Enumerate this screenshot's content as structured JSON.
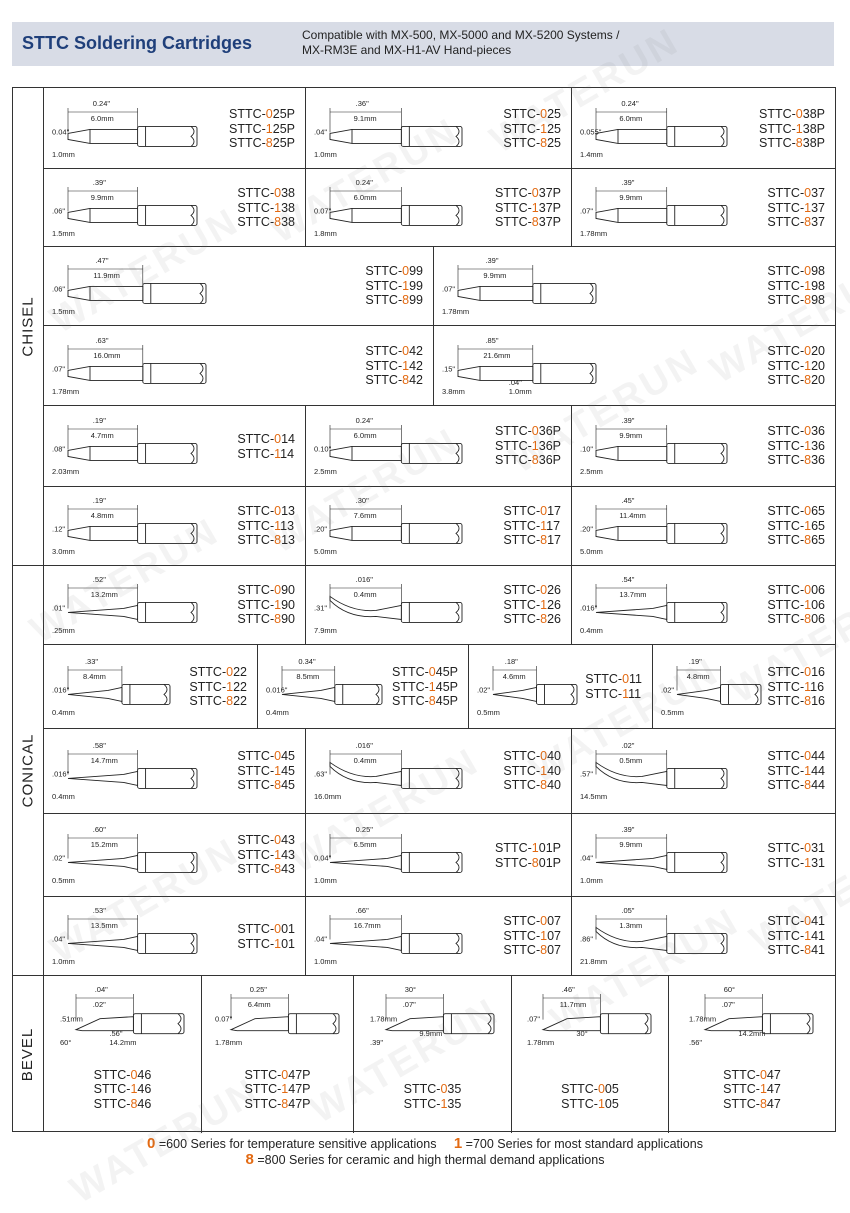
{
  "header": {
    "title": "STTC Soldering Cartridges",
    "compat_line1": "Compatible with MX-500, MX-5000 and MX-5200 Systems /",
    "compat_line2": "MX-RM3E and MX-H1-AV Hand-pieces"
  },
  "sections": [
    {
      "label": "CHISEL"
    },
    {
      "label": "CONICAL"
    },
    {
      "label": "BEVEL"
    }
  ],
  "watermark": "WATERUN",
  "rows": [
    {
      "cells": [
        {
          "parts": [
            [
              "STTC-",
              "0",
              "25P"
            ],
            [
              "STTC-",
              "1",
              "25P"
            ],
            [
              "STTC-",
              "8",
              "25P"
            ]
          ],
          "dims": [
            "0.24\"",
            "6.0mm",
            "0.04\"",
            "1.0mm"
          ]
        },
        {
          "parts": [
            [
              "STTC-",
              "0",
              "25"
            ],
            [
              "STTC-",
              "1",
              "25"
            ],
            [
              "STTC-",
              "8",
              "25"
            ]
          ],
          "dims": [
            ".36\"",
            "9.1mm",
            ".04\"",
            "1.0mm"
          ]
        },
        {
          "parts": [
            [
              "STTC-",
              "0",
              "38P"
            ],
            [
              "STTC-",
              "1",
              "38P"
            ],
            [
              "STTC-",
              "8",
              "38P"
            ]
          ],
          "dims": [
            "0.24\"",
            "6.0mm",
            "0.055\"",
            "1.4mm"
          ]
        }
      ]
    },
    {
      "cells": [
        {
          "parts": [
            [
              "STTC-",
              "0",
              "38"
            ],
            [
              "STTC-",
              "1",
              "38"
            ],
            [
              "STTC-",
              "8",
              "38"
            ]
          ],
          "dims": [
            ".39\"",
            "9.9mm",
            ".06\"",
            "1.5mm"
          ]
        },
        {
          "parts": [
            [
              "STTC-",
              "0",
              "37P"
            ],
            [
              "STTC-",
              "1",
              "37P"
            ],
            [
              "STTC-",
              "8",
              "37P"
            ]
          ],
          "dims": [
            "0.24\"",
            "6.0mm",
            "0.07\"",
            "1.8mm"
          ]
        },
        {
          "parts": [
            [
              "STTC-",
              "0",
              "37"
            ],
            [
              "STTC-",
              "1",
              "37"
            ],
            [
              "STTC-",
              "8",
              "37"
            ]
          ],
          "dims": [
            ".39\"",
            "9.9mm",
            ".07\"",
            "1.78mm"
          ]
        }
      ]
    },
    {
      "cells": [
        {
          "parts": [
            [
              "STTC-",
              "0",
              "99"
            ],
            [
              "STTC-",
              "1",
              "99"
            ],
            [
              "STTC-",
              "8",
              "99"
            ]
          ],
          "dims": [
            ".47\"",
            "11.9mm",
            ".06\"",
            "1.5mm"
          ]
        },
        {
          "parts": [
            [
              "STTC-",
              "0",
              "98"
            ],
            [
              "STTC-",
              "1",
              "98"
            ],
            [
              "STTC-",
              "8",
              "98"
            ]
          ],
          "dims": [
            ".39\"",
            "9.9mm",
            ".07\"",
            "1.78mm"
          ]
        }
      ]
    },
    {
      "cells": [
        {
          "parts": [
            [
              "STTC-",
              "0",
              "42"
            ],
            [
              "STTC-",
              "1",
              "42"
            ],
            [
              "STTC-",
              "8",
              "42"
            ]
          ],
          "dims": [
            ".63\"",
            "16.0mm",
            ".07\"",
            "1.78mm"
          ]
        },
        {
          "parts": [
            [
              "STTC-",
              "0",
              "20"
            ],
            [
              "STTC-",
              "1",
              "20"
            ],
            [
              "STTC-",
              "8",
              "20"
            ]
          ],
          "dims": [
            ".85\"",
            "21.6mm",
            ".15\"",
            "3.8mm",
            ".04\"",
            "1.0mm"
          ]
        }
      ]
    },
    {
      "cells": [
        {
          "parts": [
            [
              "STTC-",
              "0",
              "14"
            ],
            [
              "STTC-",
              "1",
              "14"
            ]
          ],
          "dims": [
            ".19\"",
            "4.7mm",
            ".08\"",
            "2.03mm"
          ]
        },
        {
          "parts": [
            [
              "STTC-",
              "0",
              "36P"
            ],
            [
              "STTC-",
              "1",
              "36P"
            ],
            [
              "STTC-",
              "8",
              "36P"
            ]
          ],
          "dims": [
            "0.24\"",
            "6.0mm",
            "0.10\"",
            "2.5mm"
          ]
        },
        {
          "parts": [
            [
              "STTC-",
              "0",
              "36"
            ],
            [
              "STTC-",
              "1",
              "36"
            ],
            [
              "STTC-",
              "8",
              "36"
            ]
          ],
          "dims": [
            ".39\"",
            "9.9mm",
            ".10\"",
            "2.5mm"
          ]
        }
      ]
    },
    {
      "cells": [
        {
          "parts": [
            [
              "STTC-",
              "0",
              "13"
            ],
            [
              "STTC-",
              "1",
              "13"
            ],
            [
              "STTC-",
              "8",
              "13"
            ]
          ],
          "dims": [
            ".19\"",
            "4.8mm",
            ".12\"",
            "3.0mm"
          ]
        },
        {
          "parts": [
            [
              "STTC-",
              "0",
              "17"
            ],
            [
              "STTC-",
              "1",
              "17"
            ],
            [
              "STTC-",
              "8",
              "17"
            ]
          ],
          "dims": [
            ".30\"",
            "7.6mm",
            ".20\"",
            "5.0mm"
          ]
        },
        {
          "parts": [
            [
              "STTC-",
              "0",
              "65"
            ],
            [
              "STTC-",
              "1",
              "65"
            ],
            [
              "STTC-",
              "8",
              "65"
            ]
          ],
          "dims": [
            ".45\"",
            "11.4mm",
            ".20\"",
            "5.0mm"
          ]
        }
      ]
    },
    {
      "cells": [
        {
          "parts": [
            [
              "STTC-",
              "0",
              "90"
            ],
            [
              "STTC-",
              "1",
              "90"
            ],
            [
              "STTC-",
              "8",
              "90"
            ]
          ],
          "dims": [
            ".52\"",
            "13.2mm",
            ".01\"",
            ".25mm"
          ]
        },
        {
          "parts": [
            [
              "STTC-",
              "0",
              "26"
            ],
            [
              "STTC-",
              "1",
              "26"
            ],
            [
              "STTC-",
              "8",
              "26"
            ]
          ],
          "dims": [
            ".016\"",
            "0.4mm",
            ".31\"",
            "7.9mm"
          ]
        },
        {
          "parts": [
            [
              "STTC-",
              "0",
              "06"
            ],
            [
              "STTC-",
              "1",
              "06"
            ],
            [
              "STTC-",
              "8",
              "06"
            ]
          ],
          "dims": [
            ".54\"",
            "13.7mm",
            ".016\"",
            "0.4mm"
          ]
        }
      ]
    },
    {
      "cells": [
        {
          "parts": [
            [
              "STTC-",
              "0",
              "22"
            ],
            [
              "STTC-",
              "1",
              "22"
            ],
            [
              "STTC-",
              "8",
              "22"
            ]
          ],
          "dims": [
            ".33\"",
            "8.4mm",
            ".016\"",
            "0.4mm"
          ]
        },
        {
          "parts": [
            [
              "STTC-",
              "0",
              "45P"
            ],
            [
              "STTC-",
              "1",
              "45P"
            ],
            [
              "STTC-",
              "8",
              "45P"
            ]
          ],
          "dims": [
            "0.34\"",
            "8.5mm",
            "0.016\"",
            "0.4mm"
          ]
        },
        {
          "parts": [
            [
              "STTC-",
              "0",
              "11"
            ],
            [
              "STTC-",
              "1",
              "11"
            ]
          ],
          "dims": [
            ".18\"",
            "4.6mm",
            ".02\"",
            "0.5mm"
          ]
        },
        {
          "parts": [
            [
              "STTC-",
              "0",
              "16"
            ],
            [
              "STTC-",
              "1",
              "16"
            ],
            [
              "STTC-",
              "8",
              "16"
            ]
          ],
          "dims": [
            ".19\"",
            "4.8mm",
            ".02\"",
            "0.5mm"
          ]
        }
      ]
    },
    {
      "cells": [
        {
          "parts": [
            [
              "STTC-",
              "0",
              "45"
            ],
            [
              "STTC-",
              "1",
              "45"
            ],
            [
              "STTC-",
              "8",
              "45"
            ]
          ],
          "dims": [
            ".58\"",
            "14.7mm",
            ".016\"",
            "0.4mm"
          ]
        },
        {
          "parts": [
            [
              "STTC-",
              "0",
              "40"
            ],
            [
              "STTC-",
              "1",
              "40"
            ],
            [
              "STTC-",
              "8",
              "40"
            ]
          ],
          "dims": [
            ".016\"",
            "0.4mm",
            ".63\"",
            "16.0mm"
          ]
        },
        {
          "parts": [
            [
              "STTC-",
              "0",
              "44"
            ],
            [
              "STTC-",
              "1",
              "44"
            ],
            [
              "STTC-",
              "8",
              "44"
            ]
          ],
          "dims": [
            ".02\"",
            "0.5mm",
            ".57\"",
            "14.5mm"
          ]
        }
      ]
    },
    {
      "cells": [
        {
          "parts": [
            [
              "STTC-",
              "0",
              "43"
            ],
            [
              "STTC-",
              "1",
              "43"
            ],
            [
              "STTC-",
              "8",
              "43"
            ]
          ],
          "dims": [
            ".60\"",
            "15.2mm",
            ".02\"",
            "0.5mm"
          ]
        },
        {
          "parts": [
            [
              "STTC-",
              "1",
              "01P"
            ],
            [
              "STTC-",
              "8",
              "01P"
            ]
          ],
          "dims": [
            "0.25\"",
            "6.5mm",
            "0.04\"",
            "1.0mm"
          ]
        },
        {
          "parts": [
            [
              "STTC-",
              "0",
              "31"
            ],
            [
              "STTC-",
              "1",
              "31"
            ]
          ],
          "dims": [
            ".39\"",
            "9.9mm",
            ".04\"",
            "1.0mm"
          ]
        }
      ]
    },
    {
      "cells": [
        {
          "parts": [
            [
              "STTC-",
              "0",
              "01"
            ],
            [
              "STTC-",
              "1",
              "01"
            ]
          ],
          "dims": [
            ".53\"",
            "13.5mm",
            ".04\"",
            "1.0mm"
          ]
        },
        {
          "parts": [
            [
              "STTC-",
              "0",
              "07"
            ],
            [
              "STTC-",
              "1",
              "07"
            ],
            [
              "STTC-",
              "8",
              "07"
            ]
          ],
          "dims": [
            ".66\"",
            "16.7mm",
            ".04\"",
            "1.0mm"
          ]
        },
        {
          "parts": [
            [
              "STTC-",
              "0",
              "41"
            ],
            [
              "STTC-",
              "1",
              "41"
            ],
            [
              "STTC-",
              "8",
              "41"
            ]
          ],
          "dims": [
            ".05\"",
            "1.3mm",
            ".86\"",
            "21.8mm"
          ]
        }
      ]
    },
    {
      "cells": [
        {
          "parts": [
            [
              "STTC-",
              "0",
              "46"
            ],
            [
              "STTC-",
              "1",
              "46"
            ],
            [
              "STTC-",
              "8",
              "46"
            ]
          ],
          "dims": [
            ".04\"",
            ".02\"",
            ".51mm",
            "60°",
            ".56\"",
            "14.2mm"
          ]
        },
        {
          "parts": [
            [
              "STTC-",
              "0",
              "47P"
            ],
            [
              "STTC-",
              "1",
              "47P"
            ],
            [
              "STTC-",
              "8",
              "47P"
            ]
          ],
          "dims": [
            "0.25\"",
            "6.4mm",
            "0.07\"",
            "1.78mm"
          ]
        },
        {
          "parts": [
            [
              "STTC-",
              "0",
              "35"
            ],
            [
              "STTC-",
              "1",
              "35"
            ]
          ],
          "dims": [
            "30°",
            ".07\"",
            "1.78mm",
            ".39\"",
            "9.9mm"
          ]
        },
        {
          "parts": [
            [
              "STTC-",
              "0",
              "05"
            ],
            [
              "STTC-",
              "1",
              "05"
            ]
          ],
          "dims": [
            ".46\"",
            "11.7mm",
            ".07\"",
            "1.78mm",
            "30°"
          ]
        },
        {
          "parts": [
            [
              "STTC-",
              "0",
              "47"
            ],
            [
              "STTC-",
              "1",
              "47"
            ],
            [
              "STTC-",
              "8",
              "47"
            ]
          ],
          "dims": [
            "60°",
            ".07\"",
            "1.78mm",
            ".56\"",
            "14.2mm"
          ]
        }
      ]
    }
  ],
  "footer": {
    "n0": "0",
    "t0": "=600 Series for temperature sensitive applications",
    "n1": "1",
    "t1": "=700 Series for most standard applications",
    "n8": "8",
    "t8": "=800 Series for ceramic and high thermal demand applications"
  },
  "colors": {
    "accent": "#e36a12",
    "title": "#1f3f7a",
    "header_bg": "#d8dce6"
  }
}
